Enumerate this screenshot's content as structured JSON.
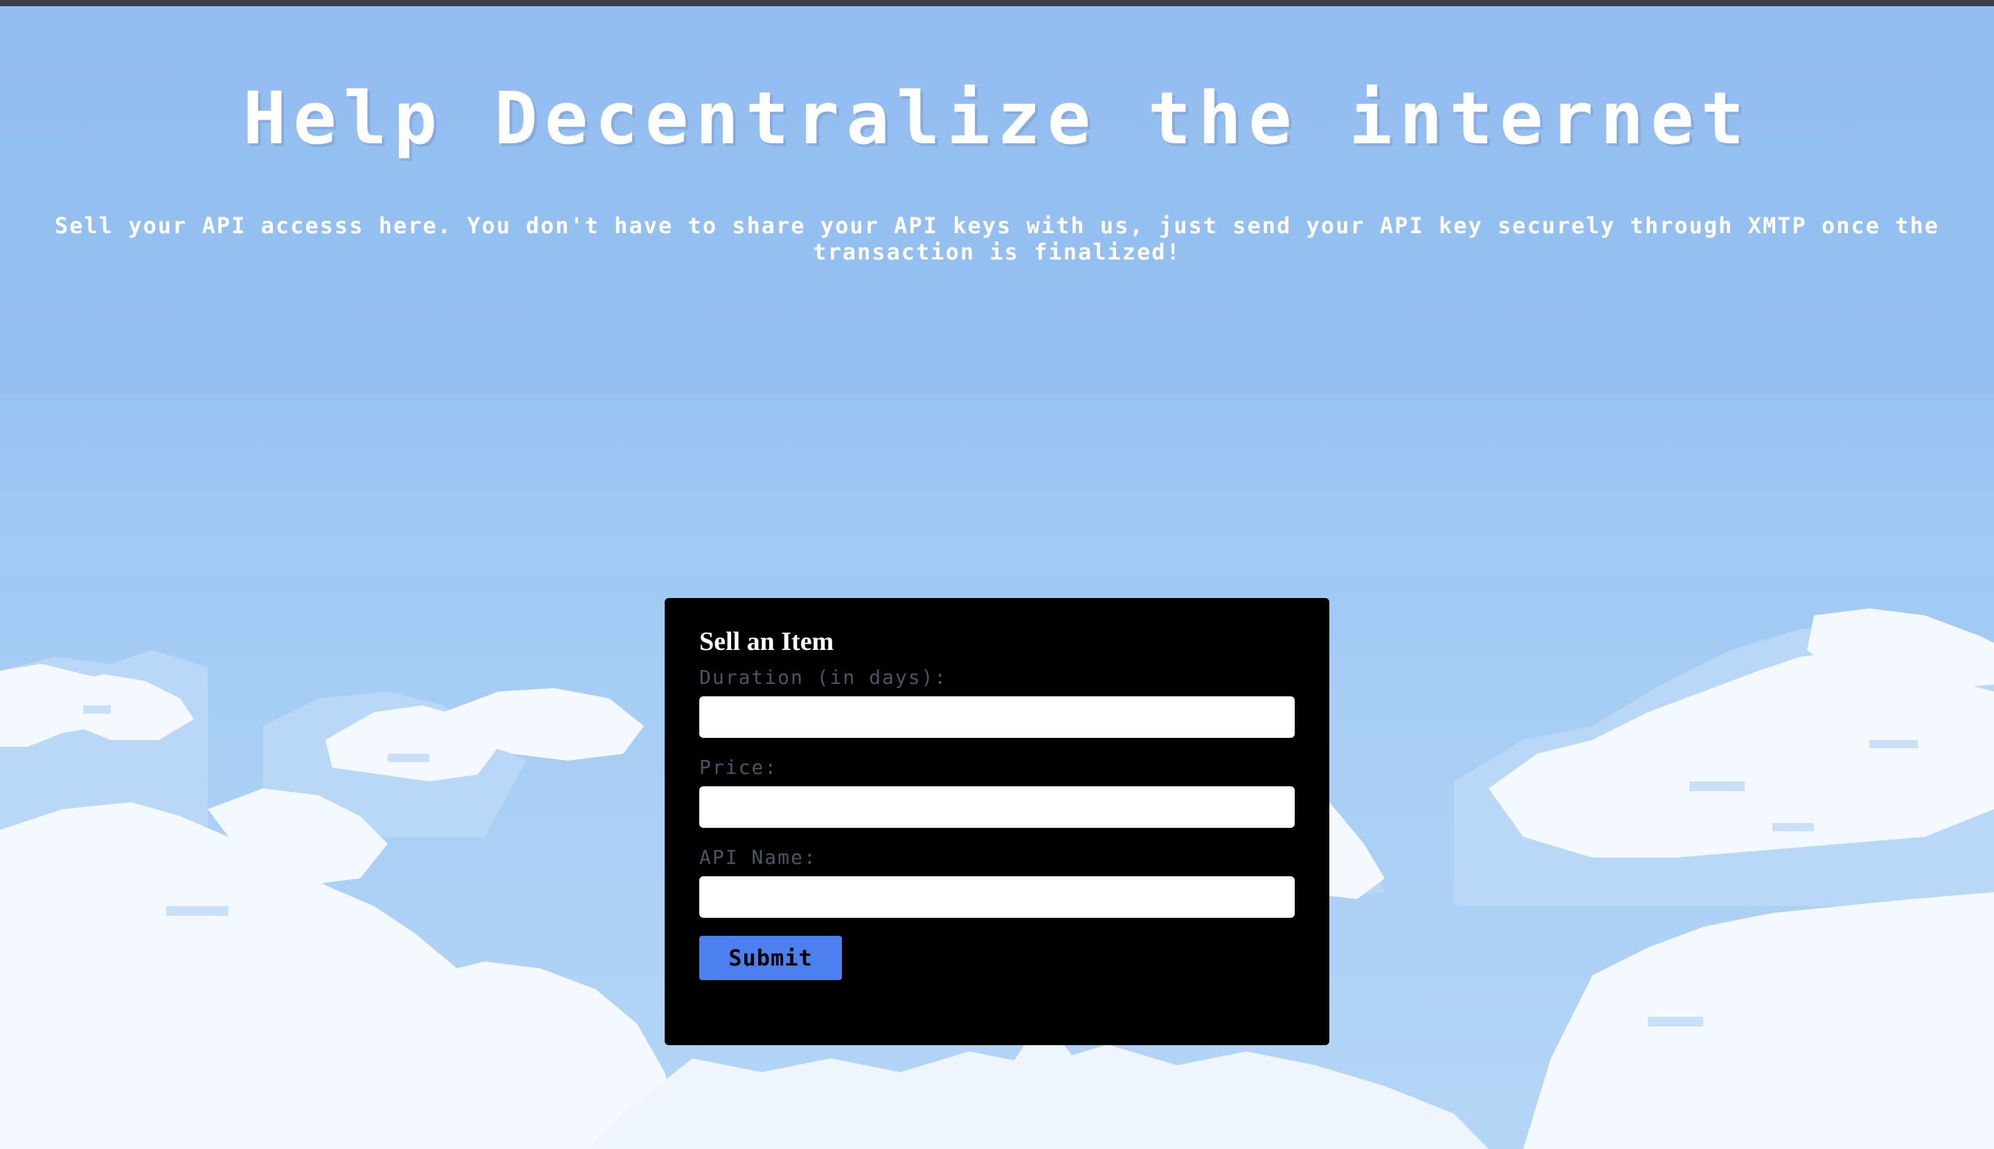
{
  "page": {
    "headline": "Help Decentralize the internet",
    "subtitle": "Sell your API accesss here. You don't have to share your API keys with us, just send your API key securely through XMTP once the transaction is finalized!"
  },
  "form": {
    "title": "Sell an Item",
    "fields": [
      {
        "label": "Duration (in days):",
        "value": "",
        "placeholder": ""
      },
      {
        "label": "Price:",
        "value": "",
        "placeholder": ""
      },
      {
        "label": "API Name:",
        "value": "",
        "placeholder": ""
      }
    ],
    "submit_label": "Submit"
  },
  "colors": {
    "sky": "#94bff0",
    "cloud": "#ffffff",
    "form_background": "#000000",
    "submit_button": "#4c80f0",
    "label_text": "#4b5566"
  }
}
